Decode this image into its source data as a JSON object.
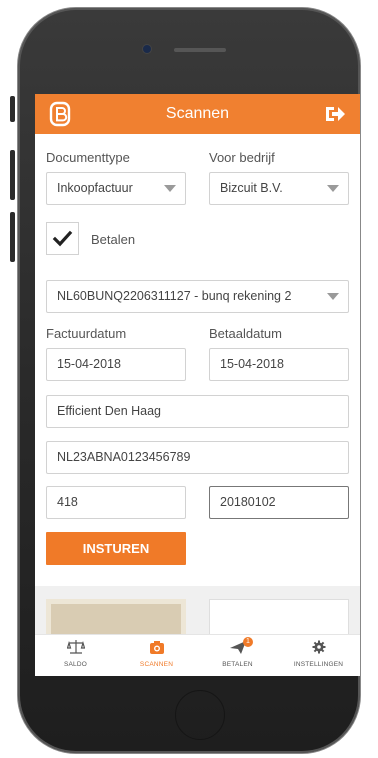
{
  "header": {
    "title": "Scannen"
  },
  "form": {
    "document_type_label": "Documenttype",
    "document_type_value": "Inkoopfactuur",
    "company_label": "Voor bedrijf",
    "company_value": "Bizcuit B.V.",
    "pay_label": "Betalen",
    "pay_checked": true,
    "account_value": "NL60BUNQ2206311127 - bunq rekening 2",
    "invoice_date_label": "Factuurdatum",
    "invoice_date_value": "15-04-2018",
    "pay_date_label": "Betaaldatum",
    "pay_date_value": "15-04-2018",
    "name_value": "Efficient Den Haag",
    "iban_value": "NL23ABNA0123456789",
    "amount_value": "418",
    "reference_value": "20180102",
    "submit_label": "INSTUREN"
  },
  "tabs": [
    {
      "label": "SALDO",
      "icon": "scale-icon"
    },
    {
      "label": "SCANNEN",
      "icon": "camera-icon",
      "active": true
    },
    {
      "label": "BETALEN",
      "icon": "send-icon",
      "badge": "1"
    },
    {
      "label": "INSTELLINGEN",
      "icon": "gear-icon"
    }
  ],
  "colors": {
    "accent": "#f08030",
    "frame": "#2a2a2a"
  }
}
